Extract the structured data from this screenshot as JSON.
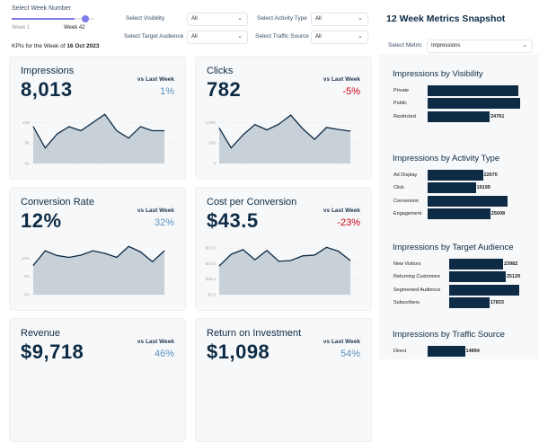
{
  "header": {
    "week_label": "Select Week Number",
    "week_min": "Week 1",
    "week_selected": "Week 42",
    "week_value": 42,
    "week_max": 52,
    "kpi_prefix": "KPIs for the  Week of",
    "kpi_date": "16 Oct 2023"
  },
  "filters": [
    {
      "label": "Select Visibility",
      "value": "All"
    },
    {
      "label": "Select Activity Type",
      "value": "All"
    },
    {
      "label": "Select Target Audience",
      "value": "All"
    },
    {
      "label": "Select Traffic Source",
      "value": "All"
    }
  ],
  "colors": {
    "accent": "#7b7ce8",
    "navy": "#0d2b45",
    "positive": "#5a93c2",
    "negative": "#d0021b",
    "area": "#c8d0d8"
  },
  "kpis": [
    {
      "title": "Impressions",
      "value": "8,013",
      "vs": "vs Last Week",
      "change": "1%",
      "positive": true,
      "yticks": [
        "10K",
        "5K",
        "0K"
      ],
      "ymax": 12.5,
      "tickvals": [
        10,
        5,
        0
      ],
      "series": [
        9,
        3.8,
        7.2,
        9,
        8,
        10,
        12,
        8,
        6.2,
        9,
        8,
        8
      ]
    },
    {
      "title": "Clicks",
      "value": "782",
      "vs": "vs Last Week",
      "change": "-5%",
      "positive": false,
      "yticks": [
        "1,000",
        "500",
        "0"
      ],
      "ymax": 1250,
      "tickvals": [
        1000,
        500,
        0
      ],
      "series": [
        870,
        380,
        700,
        950,
        820,
        960,
        1180,
        850,
        590,
        880,
        830,
        790
      ]
    },
    {
      "title": "Conversion Rate",
      "value": "12%",
      "vs": "vs Last Week",
      "change": "32%",
      "positive": true,
      "yticks": [
        "10%",
        "5%",
        "0%"
      ],
      "ymax": 14,
      "tickvals": [
        10,
        5,
        0
      ],
      "series": [
        8,
        12,
        10.7,
        10.2,
        10.8,
        12,
        11.3,
        10.2,
        13.2,
        11.7,
        9,
        12
      ]
    },
    {
      "title": "Cost per Conversion",
      "value": "$43.5",
      "vs": "vs Last Week",
      "change": "-23%",
      "positive": false,
      "yticks": [
        "$60.0",
        "$40.0",
        "$20.0",
        "$0.0"
      ],
      "ymax": 66,
      "tickvals": [
        60,
        40,
        20,
        0
      ],
      "series": [
        37,
        52,
        58,
        45,
        57,
        43,
        44,
        50,
        51,
        61,
        56,
        44
      ]
    },
    {
      "title": "Revenue",
      "value": "$9,718",
      "vs": "vs Last Week",
      "change": "46%",
      "positive": true
    },
    {
      "title": "Return on Investment",
      "value": "$1,098",
      "vs": "vs Last Week",
      "change": "54%",
      "positive": true
    }
  ],
  "snapshot": {
    "title": "12 Week Metrics Snapshot",
    "metric_label": "Select Metric",
    "metric_value": "Impressions",
    "sections": [
      {
        "title": "Impressions by Visibility",
        "rows": [
          {
            "label": "Private",
            "value": 36200,
            "shown": ""
          },
          {
            "label": "Public",
            "value": 36960,
            "shown": ""
          },
          {
            "label": "Restricted",
            "value": 24761,
            "shown": "24761"
          }
        ]
      },
      {
        "title": "Impressions by Activity Type",
        "rows": [
          {
            "label": "Ad Display",
            "value": 22070,
            "shown": "22070"
          },
          {
            "label": "Click",
            "value": 19199,
            "shown": "19199"
          },
          {
            "label": "Conversion",
            "value": 32000,
            "shown": ""
          },
          {
            "label": "Engagement",
            "value": 25008,
            "shown": "25008"
          }
        ]
      },
      {
        "title": "Impressions by Target Audience",
        "rows": [
          {
            "label": "New Visitors",
            "value": 23982,
            "shown": "23982"
          },
          {
            "label": "Returning Customers",
            "value": 25129,
            "shown": "25129"
          },
          {
            "label": "Segmented Audience",
            "value": 31200,
            "shown": ""
          },
          {
            "label": "Subscribers",
            "value": 17833,
            "shown": "17833"
          }
        ]
      },
      {
        "title": "Impressions by Traffic Source",
        "rows": [
          {
            "label": "Direct",
            "value": 14894,
            "shown": "14894"
          }
        ]
      }
    ]
  }
}
